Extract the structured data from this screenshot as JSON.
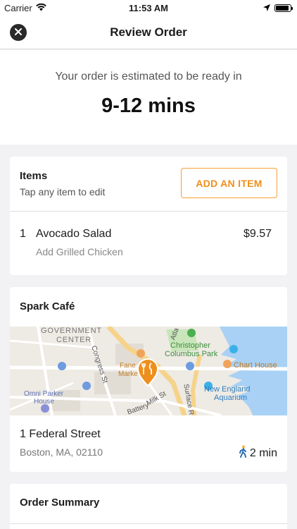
{
  "status_bar": {
    "carrier": "Carrier",
    "time": "11:53 AM",
    "battery_level": 0.9
  },
  "nav": {
    "title": "Review Order",
    "close_icon": "close-icon"
  },
  "estimate": {
    "text": "Your order is estimated to be ready in",
    "time": "9-12 mins"
  },
  "items": {
    "title": "Items",
    "subtitle": "Tap any item to edit",
    "add_button": "ADD AN ITEM",
    "list": [
      {
        "qty": "1",
        "name": "Avocado Salad",
        "modifier": "Add Grilled Chicken",
        "price": "$9.57"
      }
    ]
  },
  "store": {
    "name": "Spark Café",
    "street": "1 Federal Street",
    "city": "Boston, MA, 02110",
    "walk_time": "2 min",
    "map": {
      "labels": {
        "government": "GOVERNMENT",
        "center": "CENTER",
        "atlantic": "Atla",
        "christopher": "Christopher",
        "columbus": "Columbus Park",
        "chart_house": "Chart House",
        "congress": "Congress St",
        "faneuil": "Fane",
        "marketplace": "Marke",
        "new_england": "New England",
        "aquarium": "Aquarium",
        "surface": "Surface Rd",
        "milk": "Milk St",
        "omni": "Omni Parker",
        "house": "House",
        "battery": "Battery"
      }
    }
  },
  "summary": {
    "title": "Order Summary"
  },
  "colors": {
    "accent": "#ee8f1c",
    "water": "#a8d1f5",
    "map_land": "#eeeae4",
    "park": "#c8e6b9"
  }
}
